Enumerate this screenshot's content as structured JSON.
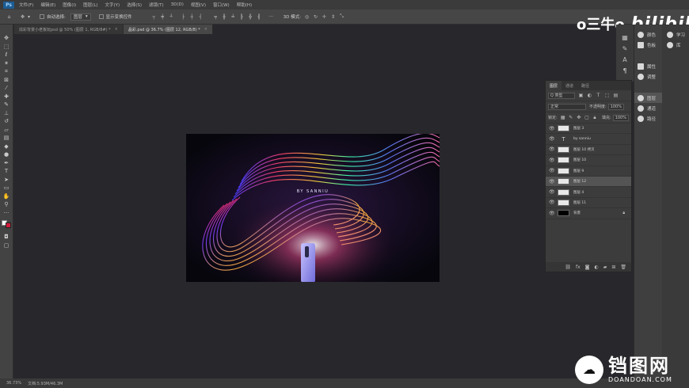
{
  "app": {
    "logo_text": "Ps"
  },
  "menu": [
    "文件(F)",
    "编辑(E)",
    "图像(I)",
    "图层(L)",
    "文字(Y)",
    "选择(S)",
    "滤镜(T)",
    "3D(D)",
    "视图(V)",
    "窗口(W)",
    "帮助(H)"
  ],
  "options": {
    "auto_select_label": "自动选择:",
    "auto_select_value": "图层",
    "show_transform_label": "显示变换控件",
    "mode_3d_label": "3D 模式:"
  },
  "tabs": [
    {
      "label": "炫彩背景小老板玩psd @ 50% (图层 1, RGB/8#) *",
      "active": false
    },
    {
      "label": "晶彩.psd @ 36.7% (图层 12, RGB/8) *",
      "active": true
    }
  ],
  "canvas": {
    "text": "BY SANNIU"
  },
  "watermark_top": {
    "left": "o三牛o",
    "right": "bilibili"
  },
  "right_columns": {
    "col1": [
      "颜色",
      "色板",
      "属性",
      "调整",
      "图层",
      "通道",
      "路径"
    ],
    "col2": [
      "学习",
      "库"
    ]
  },
  "layers_panel": {
    "tabs": [
      "图层",
      "通道",
      "路径"
    ],
    "kind_label": "Q 类型",
    "blend_mode": "正常",
    "opacity_label": "不透明度:",
    "opacity_value": "100%",
    "lock_label": "锁定:",
    "fill_label": "填充:",
    "fill_value": "100%",
    "layers": [
      {
        "name": "图层 3",
        "type": "image",
        "selected": false,
        "locked": false
      },
      {
        "name": "by sanniu",
        "type": "text",
        "selected": false,
        "locked": false
      },
      {
        "name": "图层 10 拷贝",
        "type": "image",
        "selected": false,
        "locked": false
      },
      {
        "name": "图层 10",
        "type": "image",
        "selected": false,
        "locked": false
      },
      {
        "name": "图层 9",
        "type": "image",
        "selected": false,
        "locked": false
      },
      {
        "name": "图层 12",
        "type": "image",
        "selected": true,
        "locked": false
      },
      {
        "name": "图层 4",
        "type": "image",
        "selected": false,
        "locked": false
      },
      {
        "name": "图层 11",
        "type": "image",
        "selected": false,
        "locked": false
      },
      {
        "name": "背景",
        "type": "background",
        "selected": false,
        "locked": true
      }
    ]
  },
  "status": {
    "zoom": "36.73%",
    "doc": "文档:5.93M/46.3M"
  },
  "watermark_bottom": {
    "cn": "铛图网",
    "en": "DOANDOAN.COM"
  }
}
